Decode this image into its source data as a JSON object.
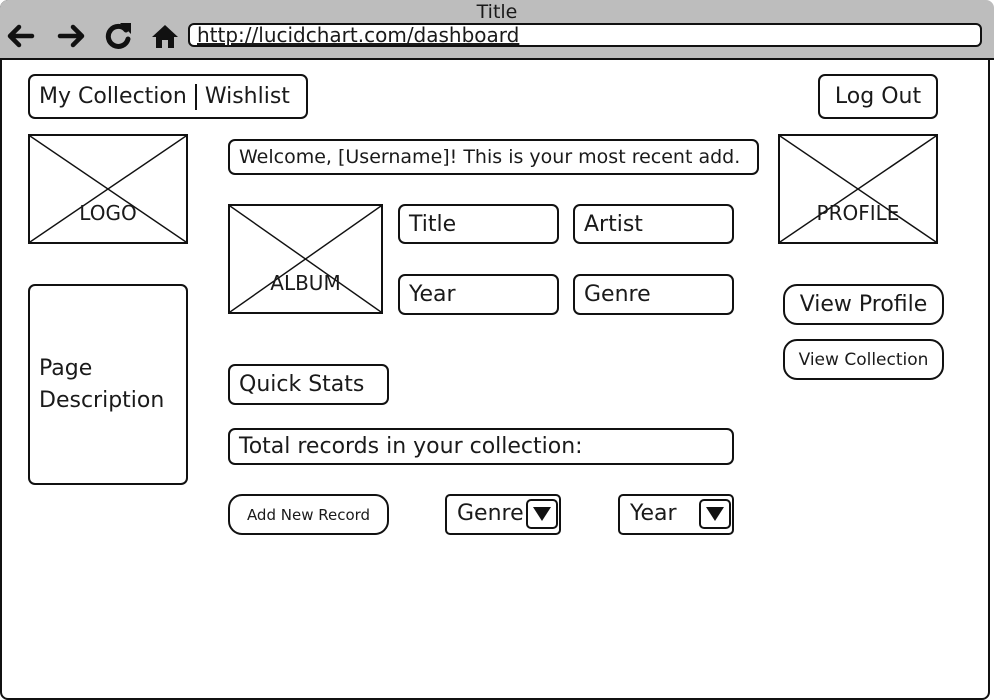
{
  "browser": {
    "window_title": "Title",
    "url": "http://lucidchart.com/dashboard",
    "icons": [
      "back-arrow-icon",
      "forward-arrow-icon",
      "reload-icon",
      "home-icon"
    ]
  },
  "nav": {
    "collection_label": "My Collection",
    "wishlist_label": "Wishlist",
    "logout_label": "Log Out"
  },
  "logo": {
    "label": "LOGO"
  },
  "profile_image": {
    "label": "PROFILE"
  },
  "sidebar": {
    "page_description": "Page Description"
  },
  "welcome": {
    "text": "Welcome, [Username]! This is your most recent add."
  },
  "recent_album": {
    "image_label": "ALBUM",
    "title_label": "Title",
    "artist_label": "Artist",
    "year_label": "Year",
    "genre_label": "Genre"
  },
  "profile_actions": {
    "view_profile_label": "View Profile",
    "view_collection_label": "View Collection"
  },
  "stats": {
    "heading": "Quick Stats",
    "total_records_label": "Total records in your collection:"
  },
  "actions": {
    "add_record_label": "Add New Record",
    "genre_filter_label": "Genre",
    "year_filter_label": "Year"
  }
}
